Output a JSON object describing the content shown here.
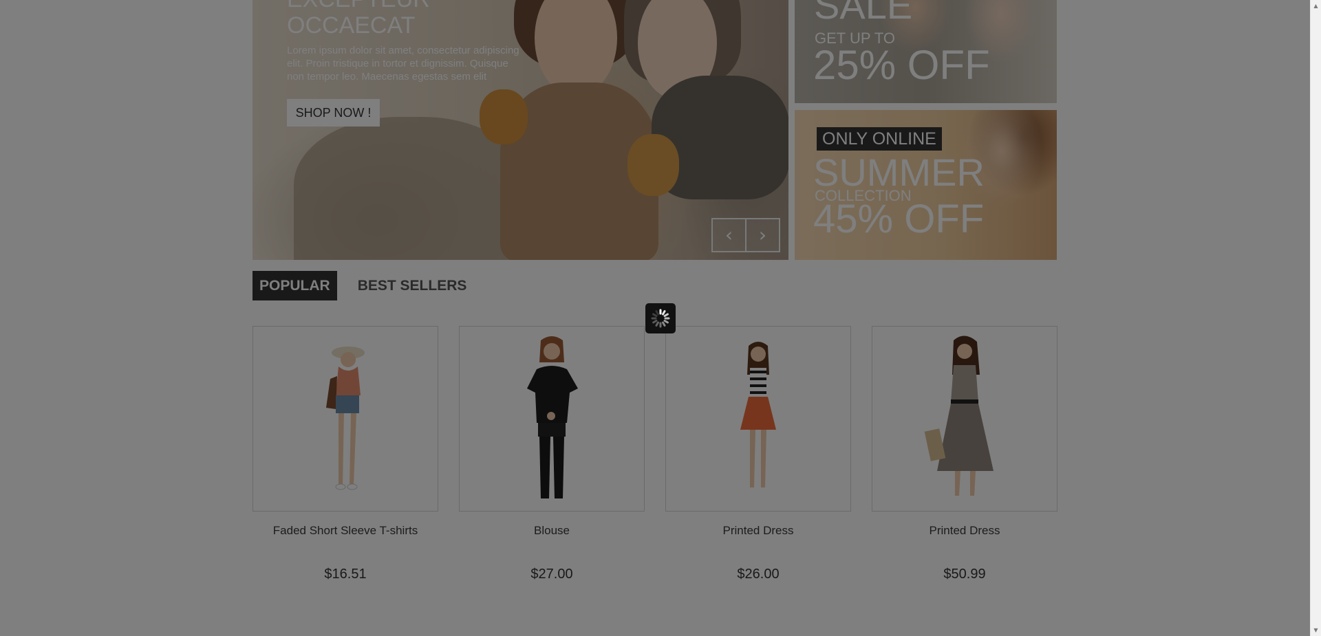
{
  "slider": {
    "title": "EXCEPTEUR OCCAECAT",
    "text": "Lorem ipsum dolor sit amet, consectetur adipiscing elit. Proin tristique in tortor et dignissim. Quisque non tempor leo. Maecenas egestas sem elit",
    "button_label": "SHOP NOW !",
    "prev_icon": "chevron-left-icon",
    "next_icon": "chevron-right-icon"
  },
  "banners": {
    "sale": {
      "headline": "SALE",
      "subline": "GET UP TO",
      "discount": "25% OFF"
    },
    "summer": {
      "badge": "ONLY ONLINE",
      "headline": "SUMMER",
      "subline": "COLLECTION",
      "discount": "45% OFF"
    }
  },
  "tabs": [
    {
      "label": "POPULAR",
      "active": true
    },
    {
      "label": "BEST SELLERS",
      "active": false
    }
  ],
  "products": [
    {
      "name": "Faded Short Sleeve T-shirts",
      "price": "$16.51"
    },
    {
      "name": "Blouse",
      "price": "$27.00"
    },
    {
      "name": "Printed Dress",
      "price": "$26.00"
    },
    {
      "name": "Printed Dress",
      "price": "$50.99"
    }
  ],
  "overlay": {
    "spinner_icon": "loading-spinner-icon"
  },
  "scrollbar": {
    "up_icon": "scroll-up-arrow-icon",
    "down_icon": "scroll-down-arrow-icon"
  },
  "colors": {
    "overlay": "#000000",
    "badge_bg": "#333333",
    "tab_active_bg": "#333333"
  }
}
